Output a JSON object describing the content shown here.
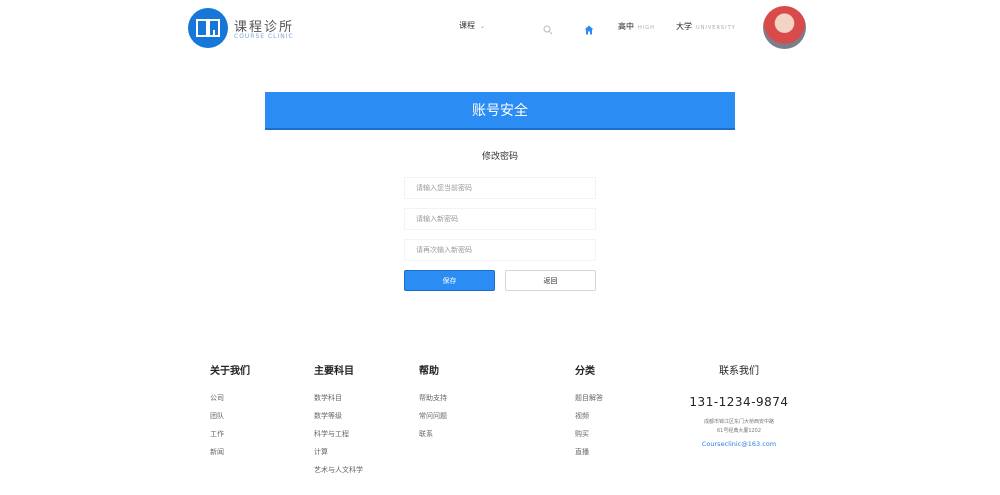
{
  "header": {
    "brand_cn": "课程诊所",
    "brand_en": "COURSE CLINIC",
    "nav": {
      "course": "课程",
      "high": "高中",
      "high_sub": "HIGH",
      "university": "大学",
      "university_sub": "UNIVERSITY"
    }
  },
  "banner": {
    "title": "账号安全"
  },
  "form": {
    "subtitle": "修改密码",
    "current_password_placeholder": "请输入您当前密码",
    "new_password_placeholder": "请输入新密码",
    "confirm_password_placeholder": "请再次输入新密码",
    "save_label": "保存",
    "back_label": "返回"
  },
  "footer": {
    "about": {
      "title": "关于我们",
      "items": [
        "公司",
        "团队",
        "工作",
        "新闻"
      ]
    },
    "subjects": {
      "title": "主要科目",
      "items": [
        "数学科目",
        "数学等级",
        "科学与工程",
        "计算",
        "艺术与人文科学"
      ]
    },
    "help": {
      "title": "帮助",
      "items": [
        "帮助支持",
        "常问问题",
        "联系"
      ]
    },
    "category": {
      "title": "分类",
      "items": [
        "题目解答",
        "视频",
        "购买",
        "直播"
      ]
    },
    "contact": {
      "title": "联系我们",
      "phone": "131-1234-9874",
      "address_line1": "成都市锦江区东门大桥西安中路",
      "address_line2": "61号经典大厦1202",
      "email": "Courseclinic@163.com"
    }
  },
  "colors": {
    "primary": "#2b8cf3",
    "logo": "#1677d8",
    "link": "#2b7fe0"
  }
}
